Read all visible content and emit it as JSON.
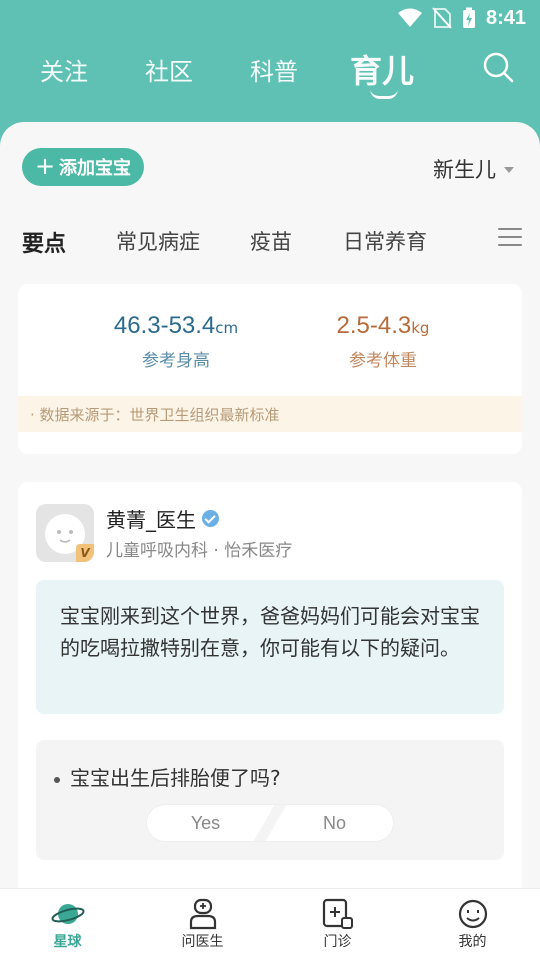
{
  "status_bar": {
    "time": "8:41"
  },
  "top_nav": {
    "tabs": [
      "关注",
      "社区",
      "科普",
      "育儿"
    ],
    "active_tab": "育儿"
  },
  "toolbar": {
    "add_baby": "添加宝宝",
    "stage": "新生儿"
  },
  "sub_tabs": [
    "要点",
    "常见病症",
    "疫苗",
    "日常养育"
  ],
  "reference": {
    "height_value": "46.3-53.4",
    "height_unit": "cm",
    "height_label": "参考身高",
    "weight_value": "2.5-4.3",
    "weight_unit": "kg",
    "weight_label": "参考体重",
    "source": "· 数据来源于：世界卫生组织最新标准"
  },
  "doctor": {
    "name": "黄菁_医生",
    "dept": "儿童呼吸内科 · 怡禾医疗",
    "badge": "V",
    "message": "宝宝刚来到这个世界，爸爸妈妈们可能会对宝宝的吃喝拉撒特别在意，你可能有以下的疑问。",
    "question": "宝宝出生后排胎便了吗?",
    "yes": "Yes",
    "no": "No"
  },
  "bottom_nav": [
    {
      "label": "星球",
      "icon": "planet-icon",
      "active": true
    },
    {
      "label": "问医生",
      "icon": "doctor-icon",
      "active": false
    },
    {
      "label": "门诊",
      "icon": "clinic-icon",
      "active": false
    },
    {
      "label": "我的",
      "icon": "profile-smile-icon",
      "active": false
    }
  ],
  "colors": {
    "header_bg": "#5ec1b3",
    "accent": "#4cb8a6",
    "height_color": "#2a6a8e",
    "weight_color": "#b86b38"
  }
}
